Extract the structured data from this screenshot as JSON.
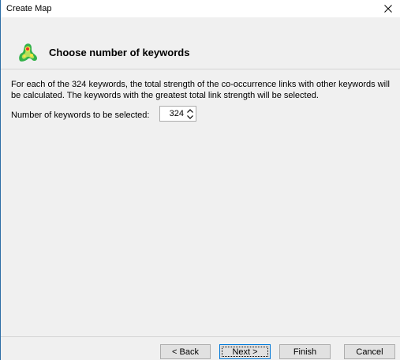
{
  "window": {
    "title": "Create Map"
  },
  "header": {
    "title": "Choose number of keywords",
    "icon": "density-map-icon"
  },
  "content": {
    "description": "For each of the 324 keywords, the total strength of the co-occurrence links with other keywords will be calculated. The keywords with the greatest total link strength will be selected.",
    "field_label": "Number of keywords to be selected:",
    "keyword_count": "324"
  },
  "footer": {
    "back_label": "< Back",
    "next_label": "Next >",
    "finish_label": "Finish",
    "cancel_label": "Cancel"
  },
  "colors": {
    "accent": "#0078d7",
    "panel_bg": "#f0f0f0",
    "button_bg": "#e1e1e1"
  }
}
